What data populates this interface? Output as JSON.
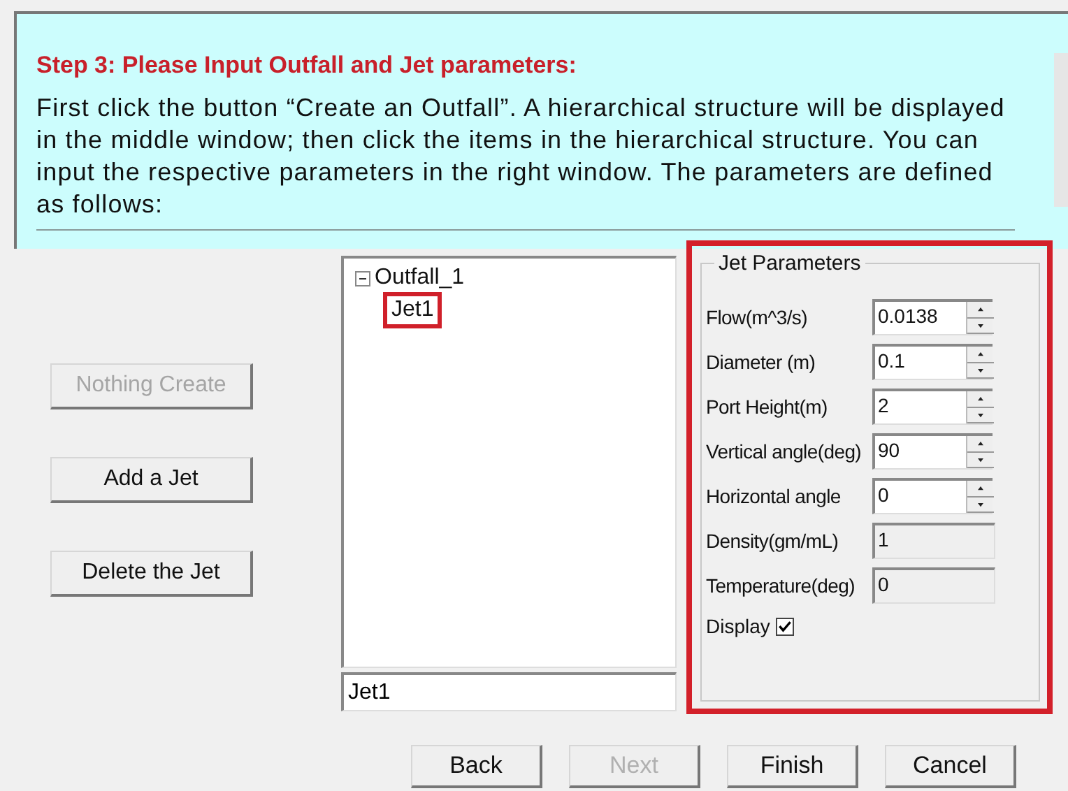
{
  "instructions": {
    "title": "Step 3: Please Input Outfall and Jet parameters:",
    "text": "First click the button “Create an Outfall”. A hierarchical structure will be displayed in the middle window; then click the items in the hierarchical structure. You can input the respective parameters in the right window. The parameters are defined as follows:"
  },
  "actions": [
    {
      "label": "Nothing Create",
      "disabled": true
    },
    {
      "label": "Add a Jet",
      "disabled": false
    },
    {
      "label": "Delete the Jet",
      "disabled": false
    }
  ],
  "tree": {
    "items": [
      {
        "label": "Outfall_1",
        "expanded": true,
        "highlighted": false,
        "children": [
          {
            "label": "Jet1",
            "highlighted": true
          }
        ]
      }
    ]
  },
  "name_field": {
    "value": "Jet1"
  },
  "jet_parameters": {
    "title": "Jet Parameters",
    "highlighted": true,
    "fields": [
      {
        "label": "Flow(m^3/s)",
        "value": "0.0138",
        "kind": "spin"
      },
      {
        "label": "Diameter (m)",
        "value": "0.1",
        "kind": "spin"
      },
      {
        "label": "Port Height(m)",
        "value": "2",
        "kind": "spin"
      },
      {
        "label": "Vertical angle(deg)",
        "value": "90",
        "kind": "spin"
      },
      {
        "label": "Horizontal angle",
        "value": "0",
        "kind": "spin"
      },
      {
        "label": "Density(gm/mL)",
        "value": "1",
        "kind": "readonly"
      },
      {
        "label": "Temperature(deg)",
        "value": "0",
        "kind": "readonly"
      }
    ],
    "display": {
      "label": "Display",
      "checked": true
    }
  },
  "wizard_buttons": [
    {
      "label": "Back",
      "disabled": false
    },
    {
      "label": "Next",
      "disabled": true
    },
    {
      "label": "Finish",
      "disabled": false
    },
    {
      "label": "Cancel",
      "disabled": false
    }
  ]
}
